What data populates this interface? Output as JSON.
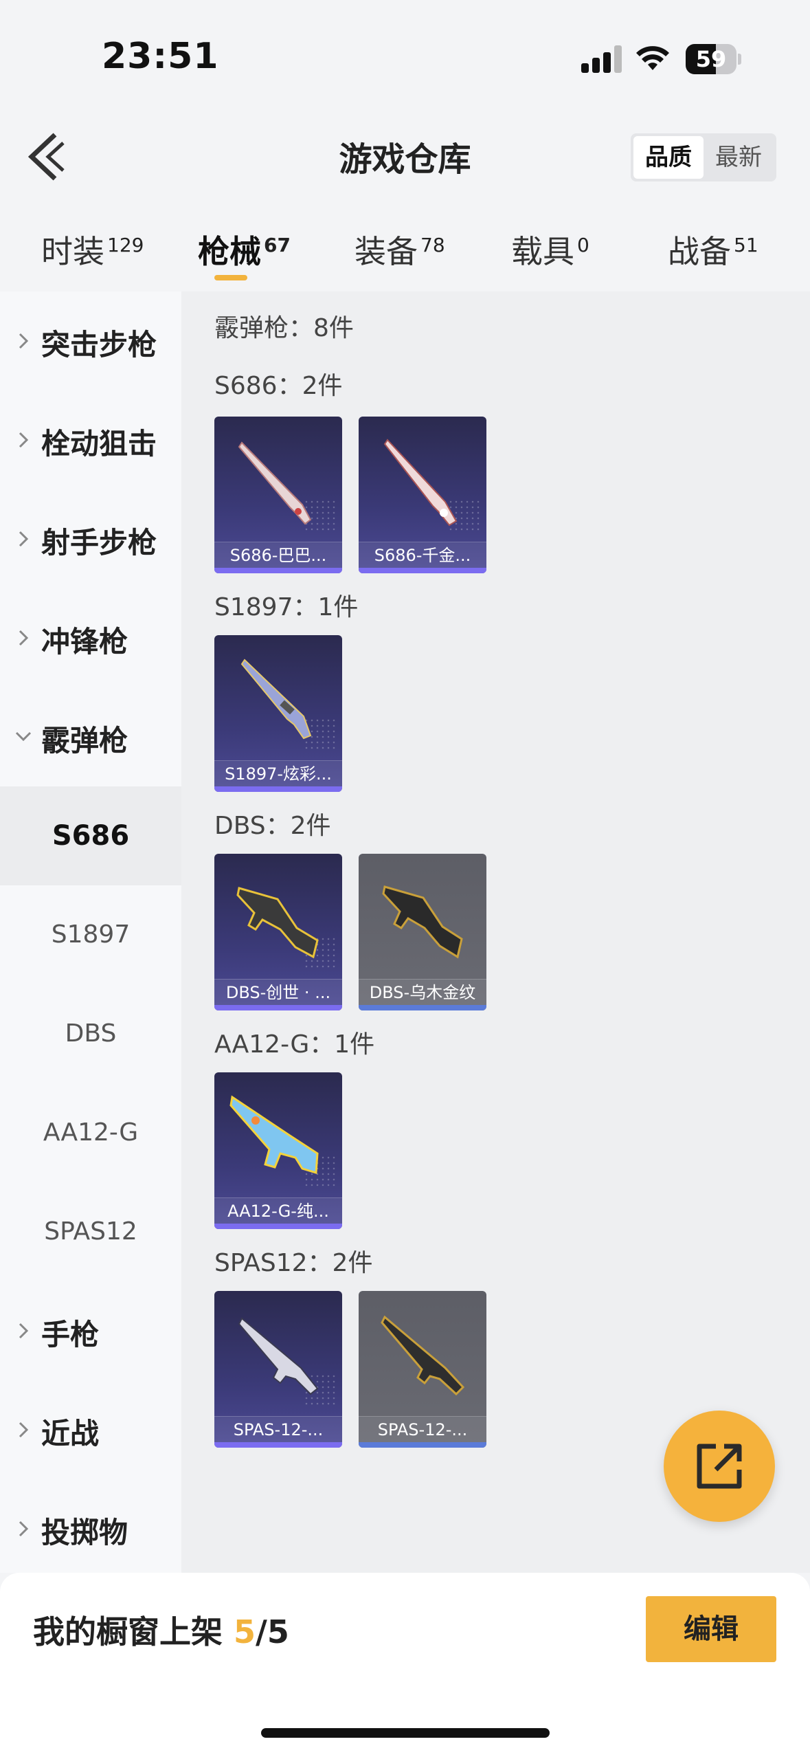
{
  "status": {
    "time": "23:51",
    "battery": "59",
    "battery_fraction": 0.59
  },
  "header": {
    "title": "游戏仓库",
    "sort_options": [
      "品质",
      "最新"
    ],
    "active_sort": "品质"
  },
  "tabs": [
    {
      "label": "时装",
      "count": "129"
    },
    {
      "label": "枪械",
      "count": "67"
    },
    {
      "label": "装备",
      "count": "78"
    },
    {
      "label": "载具",
      "count": "0"
    },
    {
      "label": "战备",
      "count": "51"
    }
  ],
  "sidebar": {
    "categories_top": [
      "突击步枪",
      "栓动狙击",
      "射手步枪",
      "冲锋枪",
      "霰弹枪"
    ],
    "subitems": [
      "S686",
      "S1897",
      "DBS",
      "AA12-G",
      "SPAS12"
    ],
    "categories_bottom": [
      "手枪",
      "近战",
      "投掷物"
    ]
  },
  "content": {
    "summary": "霰弹枪：8件",
    "groups": [
      {
        "title": "S686：2件",
        "items": [
          {
            "name": "S686-巴巴...",
            "tier": "purple"
          },
          {
            "name": "S686-千金...",
            "tier": "purple"
          }
        ]
      },
      {
        "title": "S1897：1件",
        "items": [
          {
            "name": "S1897-炫彩...",
            "tier": "purple"
          }
        ]
      },
      {
        "title": "DBS：2件",
        "items": [
          {
            "name": "DBS-创世 · ...",
            "tier": "purple"
          },
          {
            "name": "DBS-乌木金纹",
            "tier": "gray"
          }
        ]
      },
      {
        "title": "AA12-G：1件",
        "items": [
          {
            "name": "AA12-G-纯...",
            "tier": "purple"
          }
        ]
      },
      {
        "title": "SPAS12：2件",
        "items": [
          {
            "name": "SPAS-12-...",
            "tier": "purple"
          },
          {
            "name": "SPAS-12-...",
            "tier": "gray"
          }
        ]
      }
    ]
  },
  "bottom": {
    "label": "我的橱窗上架 ",
    "current": "5",
    "sep": "/",
    "max": "5",
    "edit": "编辑"
  },
  "colors": {
    "accent": "#f2b33d",
    "purple_card": "#3b3a78",
    "gray_card": "#6a6b73"
  }
}
